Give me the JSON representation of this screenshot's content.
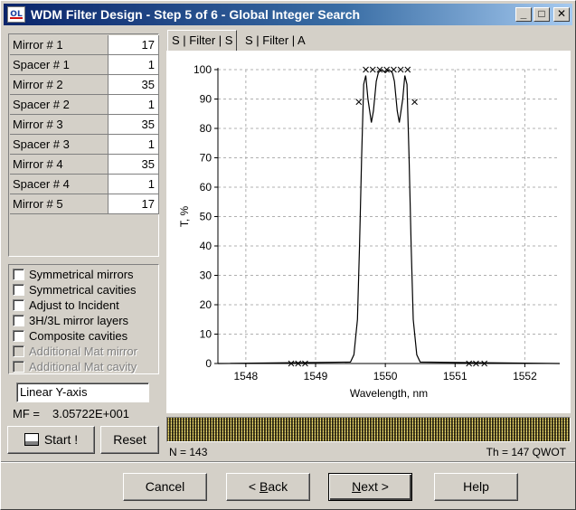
{
  "window": {
    "title": "WDM Filter Design - Step 5 of 6 - Global Integer Search",
    "app_icon_text": "OL"
  },
  "titlebar_buttons": {
    "minimize": "_",
    "maximize": "□",
    "close": "✕"
  },
  "layers": [
    {
      "label": "Mirror # 1",
      "value": "17"
    },
    {
      "label": "Spacer # 1",
      "value": "1"
    },
    {
      "label": "Mirror # 2",
      "value": "35"
    },
    {
      "label": "Spacer # 2",
      "value": "1"
    },
    {
      "label": "Mirror # 3",
      "value": "35"
    },
    {
      "label": "Spacer # 3",
      "value": "1"
    },
    {
      "label": "Mirror # 4",
      "value": "35"
    },
    {
      "label": "Spacer # 4",
      "value": "1"
    },
    {
      "label": "Mirror # 5",
      "value": "17"
    }
  ],
  "options": [
    {
      "label": "Symmetrical mirrors",
      "checked": false,
      "disabled": false
    },
    {
      "label": "Symmetrical cavities",
      "checked": false,
      "disabled": false
    },
    {
      "label": "Adjust to Incident",
      "checked": false,
      "disabled": false
    },
    {
      "label": "3H/3L mirror layers",
      "checked": false,
      "disabled": false
    },
    {
      "label": "Composite cavities",
      "checked": false,
      "disabled": false
    },
    {
      "label": "Additional Mat mirror",
      "checked": false,
      "disabled": true
    },
    {
      "label": "Additional Mat cavity",
      "checked": false,
      "disabled": true
    }
  ],
  "y_axis_mode": "Linear Y-axis",
  "mf": {
    "label": "MF =",
    "value": "3.05722E+001"
  },
  "buttons": {
    "start": "Start !",
    "reset": "Reset",
    "cancel": "Cancel",
    "back_pre": "< ",
    "back_key": "B",
    "back_post": "ack",
    "next_key": "N",
    "next_post": "ext >",
    "help": "Help"
  },
  "tabs": [
    {
      "label": "S | Filter | S",
      "active": true
    },
    {
      "label": "S | Filter | A",
      "active": false
    }
  ],
  "status": {
    "n": "N = 143",
    "th": "Th = 147 QWOT"
  },
  "colors": {
    "title_start": "#0a246a",
    "title_end": "#a6caf0",
    "face": "#d4d0c8"
  },
  "chart_data": {
    "type": "line",
    "xlabel": "Wavelength, nm",
    "ylabel": "T, %",
    "xlim": [
      1547.6,
      1552.5
    ],
    "ylim": [
      0,
      100
    ],
    "xticks": [
      1548,
      1549,
      1550,
      1551,
      1552
    ],
    "yticks": [
      0,
      10,
      20,
      30,
      40,
      50,
      60,
      70,
      80,
      90,
      100
    ],
    "grid": true,
    "series": [
      {
        "x": [
          1547.6,
          1549.5,
          1549.55,
          1549.6,
          1549.63,
          1549.66,
          1549.69,
          1549.72,
          1549.75,
          1549.8,
          1549.83,
          1549.87,
          1549.9,
          1549.95,
          1550.0,
          1550.05,
          1550.1,
          1550.13,
          1550.17,
          1550.2,
          1550.25,
          1550.28,
          1550.31,
          1550.34,
          1550.37,
          1550.4,
          1550.45,
          1550.5,
          1552.5
        ],
        "y": [
          0,
          0.5,
          3,
          15,
          40,
          70,
          95,
          98,
          90,
          82,
          86,
          96,
          99,
          100,
          99,
          100,
          99,
          96,
          86,
          82,
          90,
          98,
          95,
          70,
          40,
          15,
          3,
          0.5,
          0
        ]
      }
    ],
    "targets": {
      "x": [
        1548.65,
        1548.75,
        1548.85,
        1549.62,
        1549.72,
        1549.82,
        1549.92,
        1550.02,
        1550.12,
        1550.22,
        1550.32,
        1550.42,
        1551.2,
        1551.3,
        1551.42
      ],
      "y": [
        0,
        0,
        0,
        89,
        100,
        100,
        100,
        100,
        100,
        100,
        100,
        89,
        0,
        0,
        0
      ]
    }
  }
}
